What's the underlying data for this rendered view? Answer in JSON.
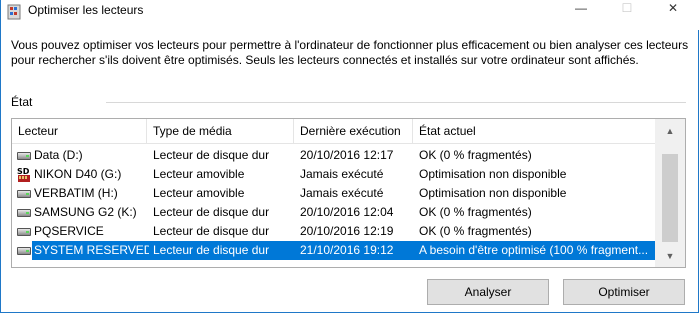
{
  "window": {
    "title": "Optimiser les lecteurs",
    "controls": {
      "minimize": "—",
      "maximize": "☐",
      "close": "✕"
    }
  },
  "description": "Vous pouvez optimiser vos lecteurs pour permettre à l'ordinateur de fonctionner plus efficacement ou bien analyser ces lecteurs pour rechercher s'ils doivent être optimisés. Seuls les lecteurs connectés et installés sur votre ordinateur sont affichés.",
  "etat_label": "État",
  "table": {
    "columns": [
      "Lecteur",
      "Type de média",
      "Dernière exécution",
      "État actuel"
    ],
    "rows": [
      {
        "icon": "hard-drive-icon",
        "lecteur": "Data (D:)",
        "type": "Lecteur de disque dur",
        "derniere": "20/10/2016 12:17",
        "etat": "OK (0 % fragmentés)",
        "selected": false
      },
      {
        "icon": "sd-card-icon",
        "lecteur": "NIKON D40 (G:)",
        "type": "Lecteur amovible",
        "derniere": "Jamais exécuté",
        "etat": "Optimisation non disponible",
        "selected": false
      },
      {
        "icon": "hard-drive-icon",
        "lecteur": "VERBATIM (H:)",
        "type": "Lecteur amovible",
        "derniere": "Jamais exécuté",
        "etat": "Optimisation non disponible",
        "selected": false
      },
      {
        "icon": "hard-drive-icon",
        "lecteur": "SAMSUNG G2 (K:)",
        "type": "Lecteur de disque dur",
        "derniere": "20/10/2016 12:04",
        "etat": "OK (0 % fragmentés)",
        "selected": false
      },
      {
        "icon": "hard-drive-icon",
        "lecteur": "PQSERVICE",
        "type": "Lecteur de disque dur",
        "derniere": "20/10/2016 12:19",
        "etat": "OK (0 % fragmentés)",
        "selected": false
      },
      {
        "icon": "hard-drive-icon",
        "lecteur": "SYSTEM RESERVED",
        "type": "Lecteur de disque dur",
        "derniere": "21/10/2016 19:12",
        "etat": "A besoin d'être optimisé (100 % fragment...",
        "selected": true
      }
    ]
  },
  "scrollbar": {
    "up": "▲",
    "down": "▼"
  },
  "buttons": {
    "analyze": "Analyser",
    "optimize": "Optimiser"
  },
  "colors": {
    "selection": "#0078d7",
    "window_border": "#1f78c8",
    "button_face": "#e1e1e1"
  }
}
